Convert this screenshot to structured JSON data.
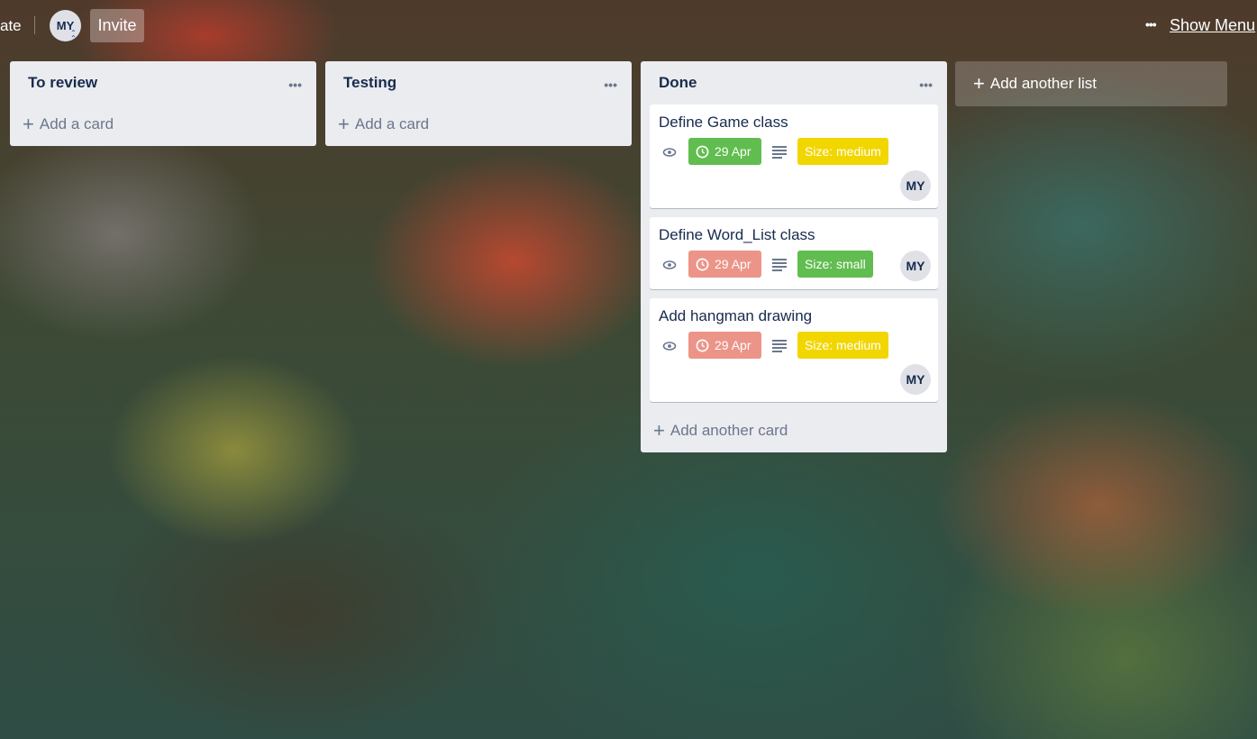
{
  "header": {
    "private_label": "ate",
    "member_initials": "MY",
    "admin_chevrons": "«",
    "invite_label": "Invite",
    "menu_dots": "•••",
    "show_menu_label": "Show Menu"
  },
  "lists": [
    {
      "title": "To review",
      "menu": "•••",
      "add_card_label": "Add a card",
      "cards": []
    },
    {
      "title": "Testing",
      "menu": "•••",
      "add_card_label": "Add a card",
      "cards": []
    },
    {
      "title": "Done",
      "menu": "•••",
      "add_card_label": "Add another card",
      "cards": [
        {
          "title": "Define Game class",
          "due": "29 Apr",
          "due_status": "complete",
          "due_color": "#61bd4f",
          "label": "Size: medium",
          "label_color": "#f2d600",
          "member": "MY",
          "icons": [
            "eye-icon",
            "clock-icon",
            "description-icon"
          ]
        },
        {
          "title": "Define Word_List class",
          "due": "29 Apr",
          "due_status": "overdue",
          "due_color": "#ec9488",
          "label": "Size: small",
          "label_color": "#61bd4f",
          "member": "MY",
          "icons": [
            "eye-icon",
            "clock-icon",
            "description-icon"
          ]
        },
        {
          "title": "Add hangman drawing",
          "due": "29 Apr",
          "due_status": "overdue",
          "due_color": "#ec9488",
          "label": "Size: medium",
          "label_color": "#f2d600",
          "member": "MY",
          "icons": [
            "eye-icon",
            "clock-icon",
            "description-icon"
          ]
        }
      ]
    }
  ],
  "add_list_label": "Add another list",
  "plus_glyph": "+"
}
